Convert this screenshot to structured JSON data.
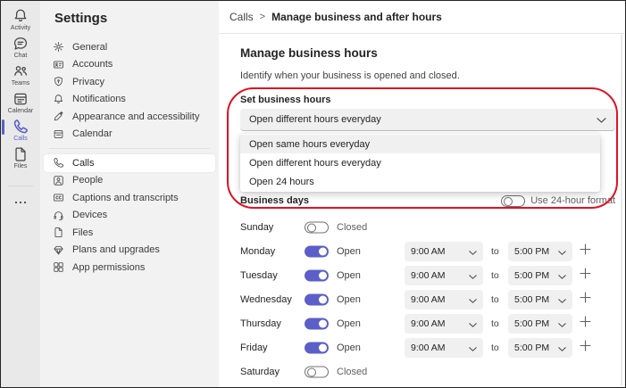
{
  "app": {
    "accent_color": "#5b5fc7",
    "annotation_color": "#dc1323"
  },
  "rail": {
    "items": [
      {
        "label": "Activity",
        "icon": "bell-icon",
        "selected": false
      },
      {
        "label": "Chat",
        "icon": "chat-icon",
        "selected": false
      },
      {
        "label": "Teams",
        "icon": "teams-people-icon",
        "selected": false
      },
      {
        "label": "Calendar",
        "icon": "calendar-icon",
        "selected": false
      },
      {
        "label": "Calls",
        "icon": "phone-icon",
        "selected": true
      },
      {
        "label": "Files",
        "icon": "file-icon",
        "selected": false
      }
    ],
    "more_icon": "more-ellipsis-icon"
  },
  "settings_panel": {
    "title": "Settings",
    "items": [
      {
        "label": "General",
        "icon": "gear-icon",
        "selected": false
      },
      {
        "label": "Accounts",
        "icon": "id-card-icon",
        "selected": false
      },
      {
        "label": "Privacy",
        "icon": "shield-icon",
        "selected": false
      },
      {
        "label": "Notifications",
        "icon": "bell-icon",
        "selected": false
      },
      {
        "label": "Appearance and accessibility",
        "icon": "pen-sparkle-icon",
        "selected": false
      },
      {
        "label": "Calendar",
        "icon": "calendar-icon",
        "selected": false
      },
      {
        "label": "Calls",
        "icon": "phone-icon",
        "selected": true
      },
      {
        "label": "People",
        "icon": "person-square-icon",
        "selected": false
      },
      {
        "label": "Captions and transcripts",
        "icon": "closed-captions-icon",
        "selected": false
      },
      {
        "label": "Devices",
        "icon": "headset-icon",
        "selected": false
      },
      {
        "label": "Files",
        "icon": "file-icon",
        "selected": false
      },
      {
        "label": "Plans and upgrades",
        "icon": "diamond-icon",
        "selected": false
      },
      {
        "label": "App permissions",
        "icon": "app-grid-icon",
        "selected": false
      }
    ]
  },
  "header": {
    "breadcrumb_parent": "Calls",
    "breadcrumb_separator": ">",
    "breadcrumb_current": "Manage business and after hours"
  },
  "main": {
    "title": "Manage business hours",
    "description": "Identify when your business is opened and closed.",
    "set_business_hours_label": "Set business hours",
    "hours_select_value": "Open different hours everyday",
    "hours_options": [
      "Open same hours everyday",
      "Open different hours everyday",
      "Open 24 hours"
    ],
    "business_days_label": "Business days",
    "use_24h_label": "Use 24-hour format",
    "to_label": "to",
    "days": [
      {
        "name": "Sunday",
        "status": "Closed",
        "open": false
      },
      {
        "name": "Monday",
        "status": "Open",
        "open": true,
        "start_time": "9:00 AM",
        "end_time": "5:00 PM"
      },
      {
        "name": "Tuesday",
        "status": "Open",
        "open": true,
        "start_time": "9:00 AM",
        "end_time": "5:00 PM"
      },
      {
        "name": "Wednesday",
        "status": "Open",
        "open": true,
        "start_time": "9:00 AM",
        "end_time": "5:00 PM"
      },
      {
        "name": "Thursday",
        "status": "Open",
        "open": true,
        "start_time": "9:00 AM",
        "end_time": "5:00 PM"
      },
      {
        "name": "Friday",
        "status": "Open",
        "open": true,
        "start_time": "9:00 AM",
        "end_time": "5:00 PM"
      },
      {
        "name": "Saturday",
        "status": "Closed",
        "open": false
      }
    ]
  }
}
